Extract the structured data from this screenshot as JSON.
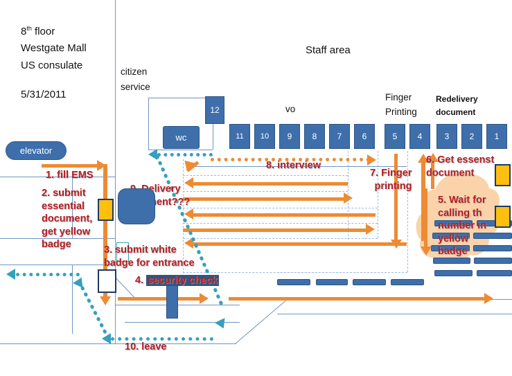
{
  "header": {
    "floor_line1": "8",
    "floor_sup": "th",
    "floor_line1b": " floor",
    "line2": "Westgate Mall",
    "line3": "US consulate",
    "date": "5/31/2011"
  },
  "rooms": {
    "elevator": "elevator",
    "citizen_service_l1": "citizen",
    "citizen_service_l2": "service",
    "staff_area": "Staff area",
    "vo": "vo",
    "finger_printing_l1": "Finger",
    "finger_printing_l2": "Printing",
    "redelivery_l1": "Redelivery",
    "redelivery_l2": "document",
    "wc": "wc"
  },
  "counters": [
    {
      "label": "12",
      "group": "citizen-service"
    },
    {
      "label": "11",
      "group": "vo"
    },
    {
      "label": "10",
      "group": "vo"
    },
    {
      "label": "9",
      "group": "vo"
    },
    {
      "label": "8",
      "group": "vo"
    },
    {
      "label": "7",
      "group": "vo"
    },
    {
      "label": "6",
      "group": "vo"
    },
    {
      "label": "5",
      "group": "finger-printing"
    },
    {
      "label": "4",
      "group": "finger-printing"
    },
    {
      "label": "3",
      "group": "redelivery-document"
    },
    {
      "label": "2",
      "group": "redelivery-document"
    },
    {
      "label": "1",
      "group": "redelivery-document"
    }
  ],
  "steps": {
    "s1": "1. fill EMS",
    "s2_l1": "2. submit",
    "s2_l2": "essential",
    "s2_l3": "document,",
    "s2_l4": "get yellow",
    "s2_l5": "badge",
    "s3_l1": "3. submit white",
    "s3_l2": "badge for entrance",
    "s4_a": "4. ",
    "s4_b": "security check",
    "s5_l1": "5. Wait for",
    "s5_l2": "calling th",
    "s5_l3": "number in",
    "s5_l4": "yellow",
    "s5_l5": "badge",
    "s6_l1": "6. Get essenst",
    "s6_l2": "document",
    "s7_l1": "7. Finger",
    "s7_l2": "printing",
    "s8": "8. interview",
    "s9_l1": "9. Delivery",
    "s9_l2": "payment???",
    "s10": "10. leave"
  },
  "colors": {
    "desk_blue": "#3e6fab",
    "desk_border": "#2e5584",
    "wall_blue": "#6f94c4",
    "arrow_orange": "#ed8b34",
    "teal": "#35a0bd",
    "step_red": "#b32025",
    "badge_yellow": "#ffbf10",
    "waiting_area": "#fbd3ab"
  }
}
